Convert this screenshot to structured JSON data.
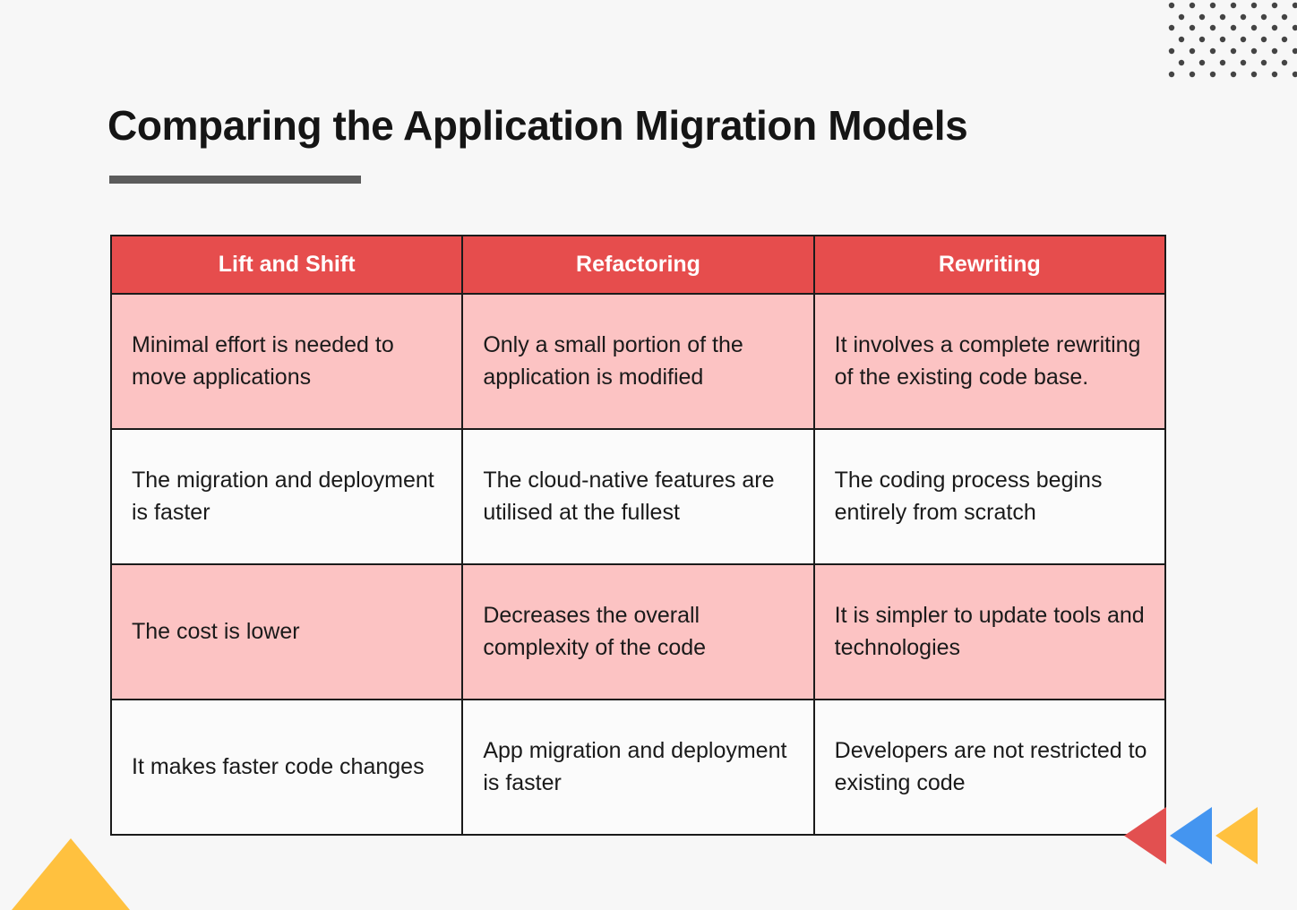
{
  "page": {
    "title": "Comparing the Application Migration Models",
    "background_color": "#F7F7F7",
    "accent_color": "#E64D4D",
    "tint_color": "#FCC3C3",
    "rule_color": "#5C5C5C"
  },
  "decorations": {
    "dot_grid": {
      "name": "dot-grid-pattern",
      "color": "#444444",
      "rows": 7,
      "cols": 7
    },
    "triangle_bottom_left": {
      "name": "triangle-up-yellow",
      "color": "#FFC13F"
    },
    "triangle_arrows": [
      {
        "name": "triangle-left-red",
        "color": "#E25050"
      },
      {
        "name": "triangle-left-blue",
        "color": "#4495F0"
      },
      {
        "name": "triangle-left-yellow",
        "color": "#FFC13F"
      }
    ]
  },
  "table": {
    "columns": [
      "Lift and Shift",
      "Refactoring",
      "Rewriting"
    ],
    "rows": [
      {
        "tint": true,
        "cells": [
          "Minimal effort is needed to move applications",
          "Only a small portion of the application is modified",
          "It involves a complete rewriting of the existing code base."
        ]
      },
      {
        "tint": false,
        "cells": [
          "The migration and deployment is faster",
          "The cloud-native features are utilised at the fullest",
          "The coding process begins entirely from scratch"
        ]
      },
      {
        "tint": true,
        "cells": [
          "The cost is lower",
          "Decreases the overall complexity of the code",
          "It is simpler to update tools and technologies"
        ]
      },
      {
        "tint": false,
        "cells": [
          "It makes faster code changes",
          "App migration and deployment is faster",
          "Developers are not restricted to existing code"
        ]
      }
    ]
  }
}
